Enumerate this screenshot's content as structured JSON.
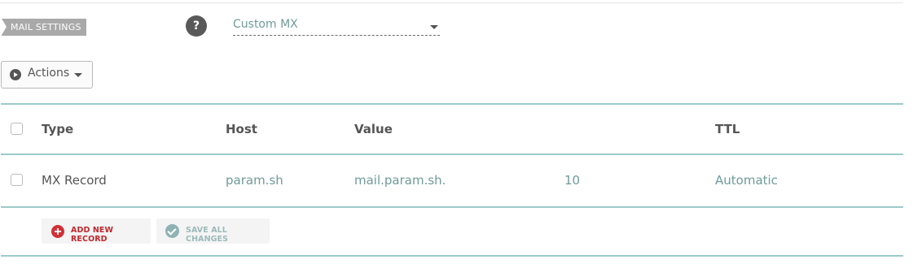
{
  "mail_settings": {
    "label": "MAIL SETTINGS",
    "help_label": "?",
    "selected_option": "Custom MX"
  },
  "actions": {
    "label": "Actions"
  },
  "table": {
    "headers": {
      "type": "Type",
      "host": "Host",
      "value": "Value",
      "ttl": "TTL"
    },
    "rows": [
      {
        "type": "MX Record",
        "host": "param.sh",
        "value": "mail.param.sh.",
        "priority": "10",
        "ttl": "Automatic"
      }
    ]
  },
  "buttons": {
    "add_new_record": "ADD NEW RECORD",
    "save_all_changes": "SAVE ALL CHANGES"
  },
  "colors": {
    "teal_text": "#6f9a9a",
    "teal_rule": "#9ccaca",
    "add_red": "#c0272d"
  }
}
